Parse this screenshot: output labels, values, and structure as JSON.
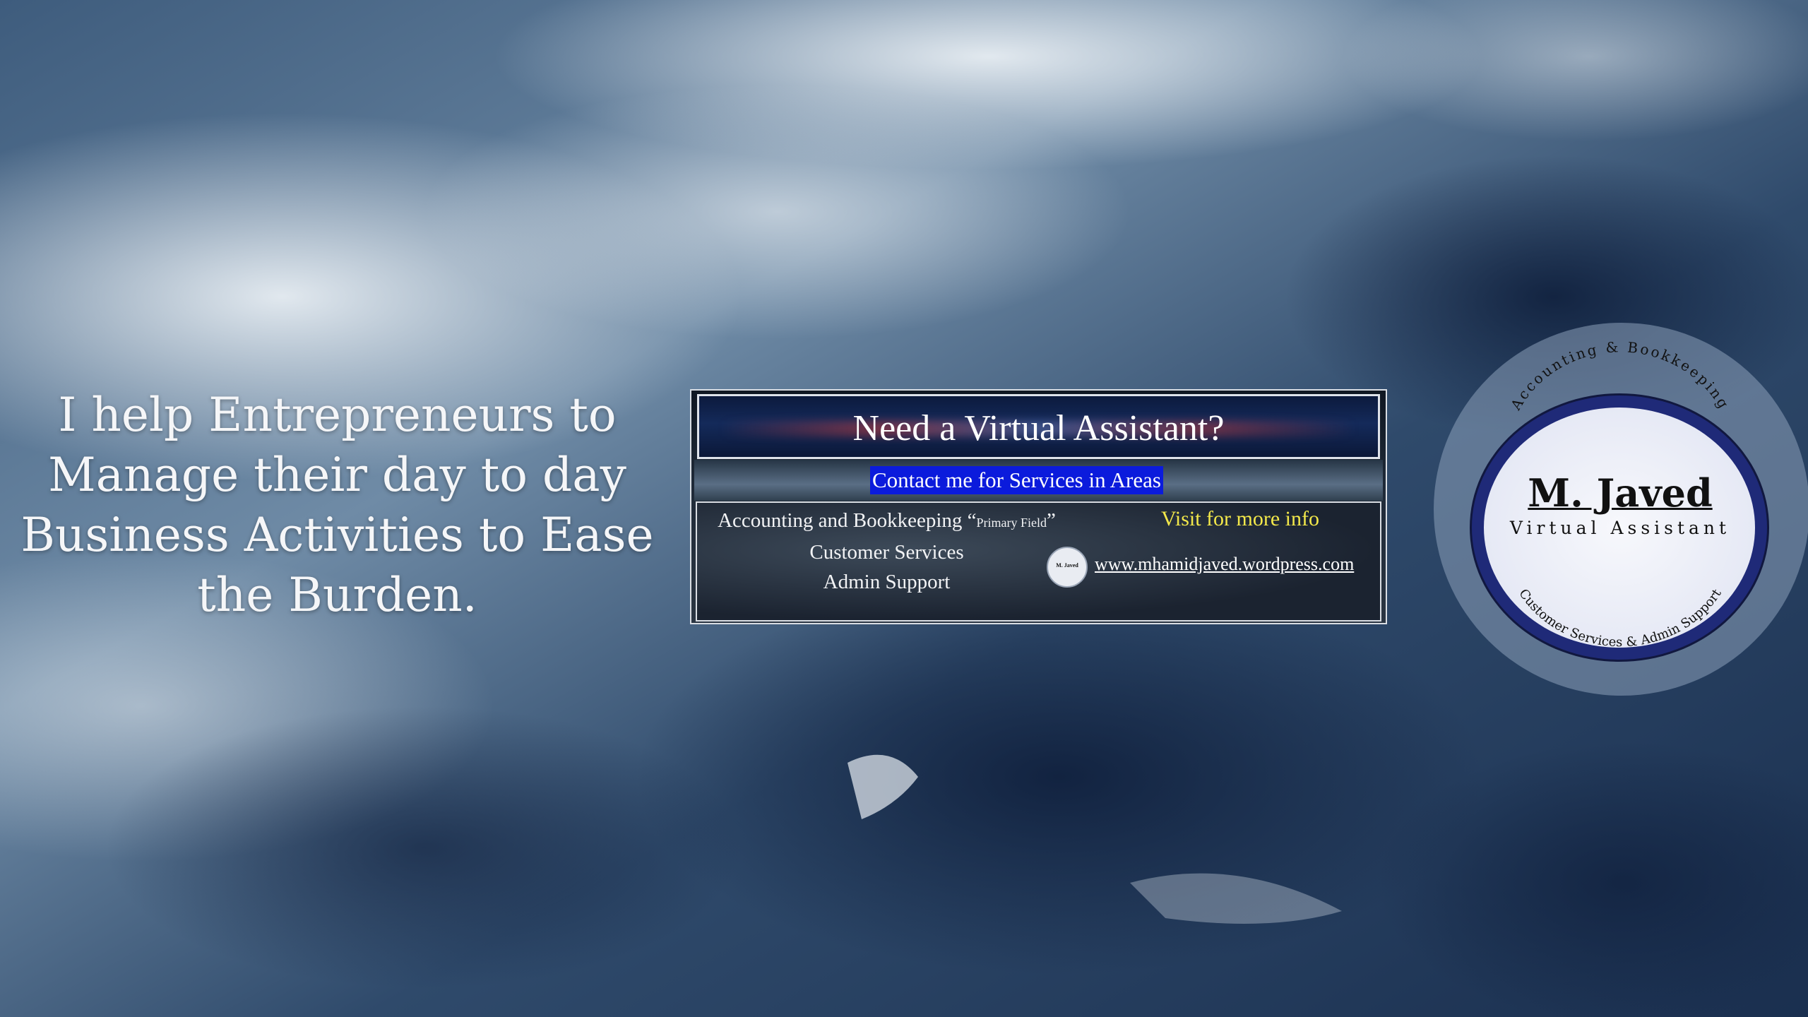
{
  "tagline": [
    "I help Entrepreneurs  to",
    "Manage their day to day",
    "Business  Activities to Ease",
    "the Burden."
  ],
  "banner": {
    "title": "Need a Virtual Assistant?",
    "contact": "Contact me for Services in Areas",
    "services": {
      "s1_main": "Accounting and Bookkeeping “",
      "s1_small": "Primary Field",
      "s1_end": "”",
      "s2": "Customer Services",
      "s3": "Admin Support"
    },
    "visit": "Visit for more info",
    "mini_logo_text": "M. Javed",
    "website": "www.mhamidjaved.wordpress.com"
  },
  "logo": {
    "name": "M. Javed",
    "subtitle": "Virtual Assistant",
    "top_arc": "Accounting & Bookkeeping",
    "bottom_arc": "Customer Services  &  Admin Support"
  },
  "colors": {
    "contact_highlight": "#0b1bdc",
    "visit_text": "#f3e84a",
    "logo_ring": "#1f2a78"
  }
}
